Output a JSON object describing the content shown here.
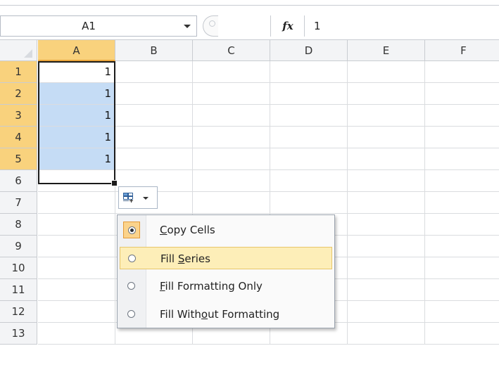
{
  "formula_bar": {
    "name_box": "A1",
    "fx_label": "fx",
    "formula_value": "1"
  },
  "columns": [
    "A",
    "B",
    "C",
    "D",
    "E",
    "F"
  ],
  "rows": [
    "1",
    "2",
    "3",
    "4",
    "5",
    "6",
    "7",
    "8",
    "9",
    "10",
    "11",
    "12",
    "13"
  ],
  "cells": {
    "A1": "1",
    "A2": "1",
    "A3": "1",
    "A4": "1",
    "A5": "1"
  },
  "autofill_options": {
    "icon": "autofill-options-icon",
    "items": [
      {
        "label": "Copy Cells",
        "accel": "C",
        "checked": true,
        "hovered": false
      },
      {
        "label": "Fill Series",
        "accel": "S",
        "checked": false,
        "hovered": true
      },
      {
        "label": "Fill Formatting Only",
        "accel": "F",
        "checked": false,
        "hovered": false
      },
      {
        "label": "Fill Without Formatting",
        "accel": "o",
        "checked": false,
        "hovered": false
      }
    ]
  },
  "colors": {
    "selected_header": "#f9d27d",
    "selection_fill": "#c5dcf5",
    "menu_hover": "#fdeeb8"
  }
}
